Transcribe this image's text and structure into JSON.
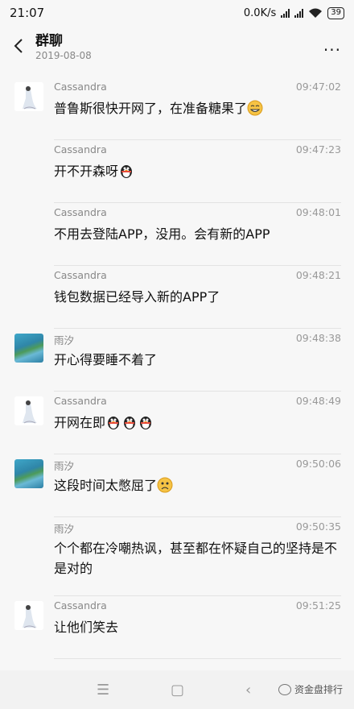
{
  "status_bar": {
    "time": "21:07",
    "network_speed": "0.0K/s",
    "battery": "39"
  },
  "header": {
    "title": "群聊",
    "date": "2019-08-08",
    "more": "..."
  },
  "messages": [
    {
      "sender": "Cassandra",
      "time": "09:47:02",
      "text": "普鲁斯很快开网了，在准备糖果了",
      "avatar": "cassandra",
      "emoji": "grin-emoji",
      "show_avatar": true
    },
    {
      "sender": "Cassandra",
      "time": "09:47:23",
      "text": "开不开森呀",
      "avatar": "cassandra",
      "emoji": "penguin-emoji",
      "show_avatar": false
    },
    {
      "sender": "Cassandra",
      "time": "09:48:01",
      "text": "不用去登陆APP，没用。会有新的APP",
      "avatar": "cassandra",
      "show_avatar": false
    },
    {
      "sender": "Cassandra",
      "time": "09:48:21",
      "text": "钱包数据已经导入新的APP了",
      "avatar": "cassandra",
      "show_avatar": false
    },
    {
      "sender": "雨汐",
      "time": "09:48:38",
      "text": "开心得要睡不着了",
      "avatar": "yuxi",
      "show_avatar": true
    },
    {
      "sender": "Cassandra",
      "time": "09:48:49",
      "text": "开网在即",
      "avatar": "cassandra",
      "emoji": "penguin-emoji",
      "emoji_count": 3,
      "show_avatar": true
    },
    {
      "sender": "雨汐",
      "time": "09:50:06",
      "text": "这段时间太憋屈了",
      "avatar": "yuxi",
      "emoji": "frown-emoji",
      "show_avatar": true
    },
    {
      "sender": "雨汐",
      "time": "09:50:35",
      "text": "个个都在冷嘲热讽，甚至都在怀疑自己的坚持是不是对的",
      "avatar": "yuxi",
      "show_avatar": false
    },
    {
      "sender": "Cassandra",
      "time": "09:51:25",
      "text": "让他们笑去",
      "avatar": "cassandra",
      "show_avatar": true
    }
  ],
  "watermark": "资金盘排行",
  "colors": {
    "background": "#f7f7f7",
    "muted_text": "#888888",
    "divider": "#e3e3e3"
  }
}
